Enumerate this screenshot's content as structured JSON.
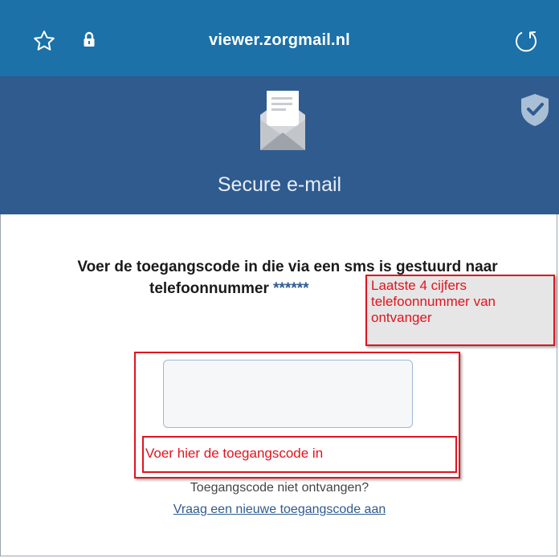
{
  "browser": {
    "url": "viewer.zorgmail.nl",
    "accent_color": "#1b71a8"
  },
  "header": {
    "title": "Secure e-mail",
    "background_color": "#2f5b8f"
  },
  "main": {
    "instruction_line1": "Voer de toegangscode in die via een sms is gestuurd naar",
    "instruction_line2_prefix": "telefoonnummer",
    "phone_mask": "******",
    "code_input": {
      "value": "",
      "placeholder": ""
    },
    "not_received_text": "Toegangscode niet ontvangen?",
    "request_new_code_link": "Vraag een nieuwe toegangscode aan"
  },
  "annotations": {
    "phone_note": "Laatste 4 cijfers telefoonnummer van ontvanger",
    "code_note": "Voer hier de toegangscode in",
    "color": "#e0141f"
  }
}
